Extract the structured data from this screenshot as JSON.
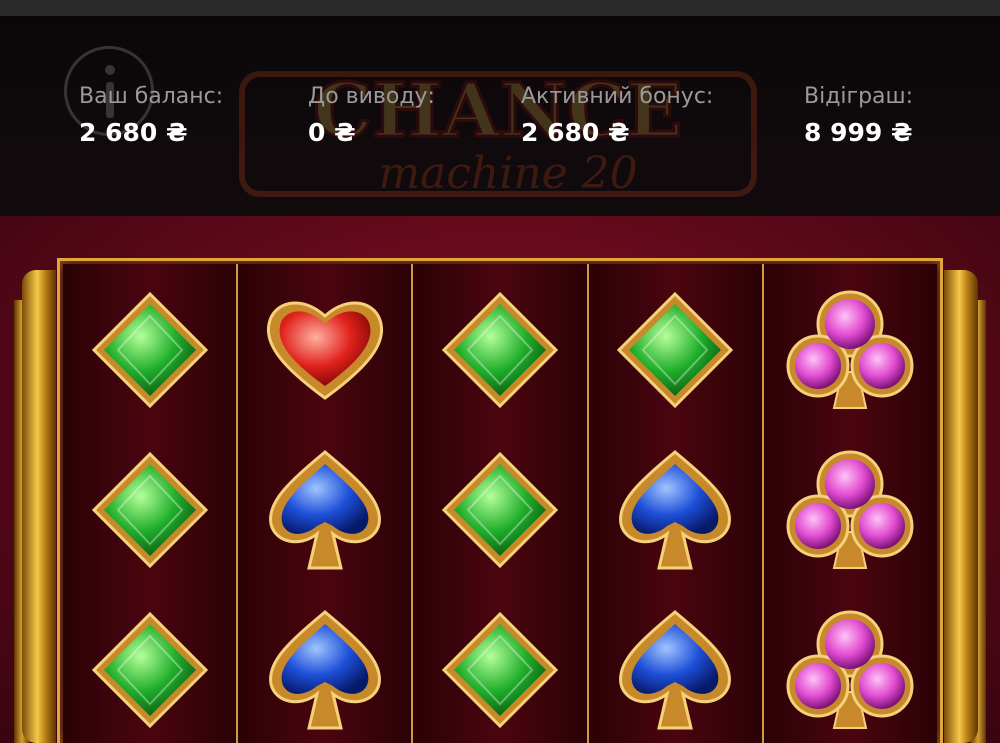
{
  "header": {
    "stats": [
      {
        "label": "Ваш баланс:",
        "value": "2 680 ₴"
      },
      {
        "label": "До виводу:",
        "value": "0 ₴"
      },
      {
        "label": "Активний бонус:",
        "value": "2 680 ₴"
      },
      {
        "label": "Відіграш:",
        "value": "8 999 ₴"
      }
    ]
  },
  "logo": {
    "line1": "CHANCE",
    "line2": "machine 20"
  },
  "reels": [
    [
      "diamond",
      "diamond",
      "diamond"
    ],
    [
      "heart",
      "spade",
      "spade"
    ],
    [
      "diamond",
      "diamond",
      "diamond"
    ],
    [
      "diamond",
      "spade",
      "spade"
    ],
    [
      "club",
      "club",
      "club"
    ]
  ],
  "symbol_colors": {
    "diamond": "#1fae2a",
    "heart": "#e0221c",
    "spade": "#1e4fd8",
    "club": "#e04ad0"
  }
}
